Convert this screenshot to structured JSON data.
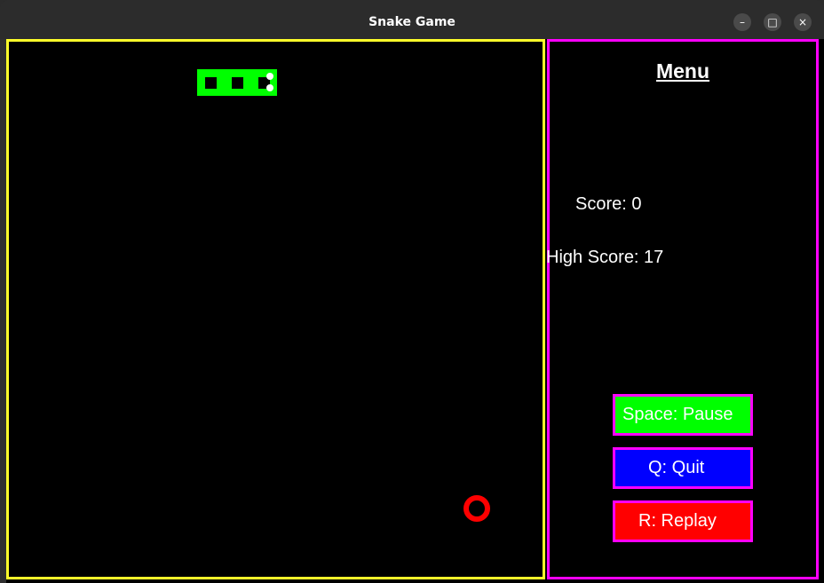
{
  "window": {
    "title": "Snake Game",
    "controls": {
      "minimize": "–",
      "maximize": "□",
      "close": "×"
    }
  },
  "menu": {
    "title": "Menu",
    "score_text": "Score: 0",
    "high_score_text": "High Score: 17",
    "buttons": [
      {
        "label": "Space: Pause",
        "color": "#00ff00"
      },
      {
        "label": "Q: Quit",
        "color": "#0000ff"
      },
      {
        "label": "R: Replay",
        "color": "#ff0000"
      }
    ]
  },
  "game": {
    "border_color": "#ffff2a",
    "menu_border_color": "#ff00ff",
    "snake_color": "#00ff00",
    "food_color": "#ff0000",
    "snake_length": 3,
    "direction": "right"
  }
}
